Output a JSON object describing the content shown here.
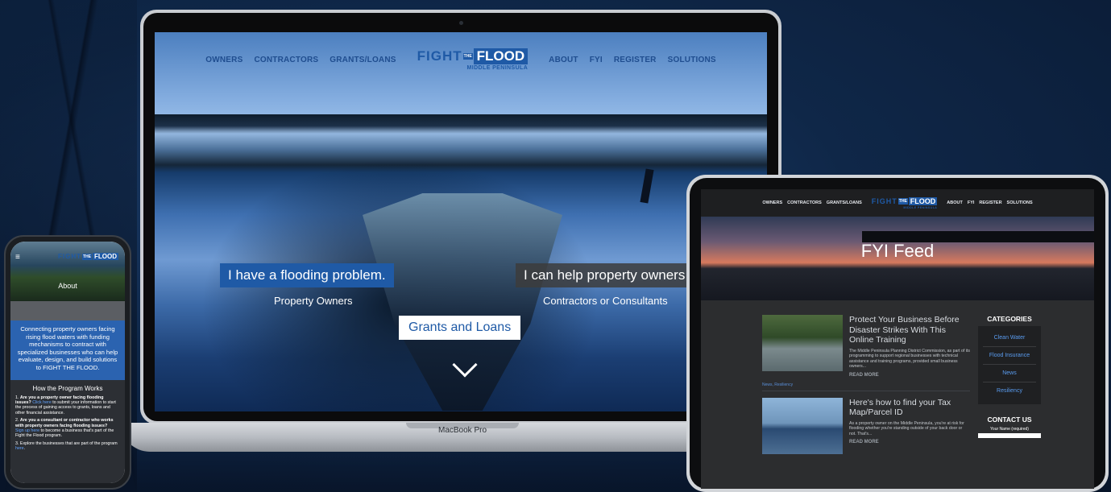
{
  "laptop": {
    "nav_left": [
      "OWNERS",
      "CONTRACTORS",
      "GRANTS/LOANS"
    ],
    "nav_right": [
      "ABOUT",
      "FYI",
      "REGISTER",
      "SOLUTIONS"
    ],
    "logo": {
      "fight": "FIGHT",
      "the": "THE",
      "flood": "FLOOD",
      "sub": "MIDDLE PENINSULA"
    },
    "cta_owner_label": "I have a flooding problem.",
    "cta_owner_caption": "Property Owners",
    "cta_contractor_label": "I can help property owners",
    "cta_contractor_caption": "Contractors or Consultants",
    "cta_grants_label": "Grants and Loans",
    "device_label": "MacBook Pro"
  },
  "phone": {
    "menu_glyph": "≡",
    "logo": {
      "fight": "FIGHT",
      "the": "THE",
      "flood": "FLOOD"
    },
    "page_title": "About",
    "intro": "Connecting property owners facing rising flood waters with funding mechanisms to contract with specialized businesses who can help evaluate, design, and build solutions to FIGHT THE FLOOD.",
    "how_title": "How the Program Works",
    "steps": [
      {
        "num": "1.",
        "question": "Are you a property owner facing flooding issues?",
        "link": "Click here",
        "rest": " to submit your information to start the process of gaining access to grants, loans and other financial assistance."
      },
      {
        "num": "2.",
        "question": "Are you a consultant or contractor who works with property owners facing flooding issues?",
        "link": "Sign up here",
        "rest": " to become a business that's part of the Fight the Flood program."
      },
      {
        "num": "3.",
        "question": "",
        "link": "here",
        "rest": "Explore the businesses that are part of the program "
      }
    ]
  },
  "tablet": {
    "nav_left": [
      "OWNERS",
      "CONTRACTORS",
      "GRANTS/LOANS"
    ],
    "nav_right": [
      "ABOUT",
      "FYI",
      "REGISTER",
      "SOLUTIONS"
    ],
    "logo": {
      "fight": "FIGHT",
      "the": "THE",
      "flood": "FLOOD",
      "sub": "MIDDLE PENINSULA"
    },
    "hero_title": "FYI Feed",
    "posts": [
      {
        "title": "Protect Your Business Before Disaster Strikes With This Online Training",
        "excerpt": "The Middle Peninsula Planning District Commission, as part of its programming to support regional businesses with technical assistance and training programs, provided small business owners...",
        "more": "READ MORE",
        "tags": "News, Resiliency"
      },
      {
        "title": "Here's how to find your Tax Map/Parcel ID",
        "excerpt": "As a property owner on the Middle Peninsula, you're at risk for flooding whether you're standing outside of your back door or not. That's...",
        "more": "READ MORE"
      }
    ],
    "categories_title": "CATEGORIES",
    "categories": [
      "Clean Water",
      "Flood Insurance",
      "News",
      "Resiliency"
    ],
    "contact_title": "CONTACT US",
    "contact_field_label": "Your Name (required)"
  },
  "colors": {
    "brand_blue": "#1f5aa6",
    "link_blue": "#5a9cf0",
    "dark_panel": "#2c2d2f"
  }
}
